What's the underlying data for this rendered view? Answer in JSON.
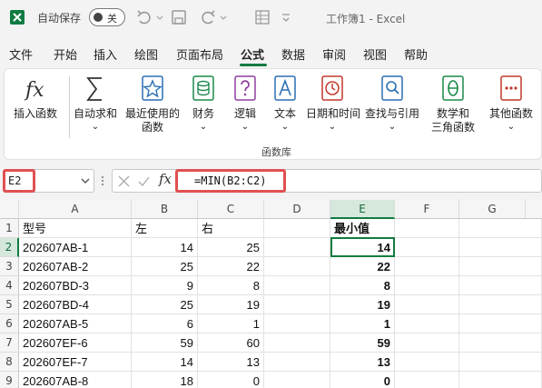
{
  "titlebar": {
    "autosave_label": "自动保存",
    "autosave_state": "关",
    "doc_title": "工作簿1  -  Excel"
  },
  "tabs": [
    "文件",
    "开始",
    "插入",
    "绘图",
    "页面布局",
    "公式",
    "数据",
    "审阅",
    "视图",
    "帮助"
  ],
  "active_tab": "公式",
  "ribbon": {
    "insert_function": "插入函数",
    "autosum": "自动求和",
    "recent": [
      "最近使用的",
      "函数"
    ],
    "financial": "财务",
    "logical": "逻辑",
    "text": "文本",
    "datetime": "日期和时间",
    "lookup": "查找与引用",
    "math": [
      "数学和",
      "三角函数"
    ],
    "other": "其他函数",
    "group_label": "函数库"
  },
  "formula_bar": {
    "name_box": "E2",
    "fx_label": "fx",
    "formula": "=MIN(B2:C2)"
  },
  "grid": {
    "columns": [
      "A",
      "B",
      "C",
      "D",
      "E",
      "F",
      "G"
    ],
    "selected_column": "E",
    "selected_row": "2",
    "headers": {
      "A": "型号",
      "B": "左",
      "C": "右",
      "E": "最小值"
    },
    "rows": [
      {
        "row": "2",
        "A": "202607AB-1",
        "B": "14",
        "C": "25",
        "E": "14"
      },
      {
        "row": "3",
        "A": "202607AB-2",
        "B": "25",
        "C": "22",
        "E": "22"
      },
      {
        "row": "4",
        "A": "202607BD-3",
        "B": "9",
        "C": "8",
        "E": "8"
      },
      {
        "row": "5",
        "A": "202607BD-4",
        "B": "25",
        "C": "19",
        "E": "19"
      },
      {
        "row": "6",
        "A": "202607AB-5",
        "B": "6",
        "C": "1",
        "E": "1"
      },
      {
        "row": "7",
        "A": "202607EF-6",
        "B": "59",
        "C": "60",
        "E": "59"
      },
      {
        "row": "8",
        "A": "202607EF-7",
        "B": "14",
        "C": "13",
        "E": "13"
      },
      {
        "row": "9",
        "A": "202607AB-8",
        "B": "18",
        "C": "0",
        "E": "0"
      }
    ]
  },
  "colors": {
    "accent": "#107c41",
    "highlight": "#e05050"
  }
}
